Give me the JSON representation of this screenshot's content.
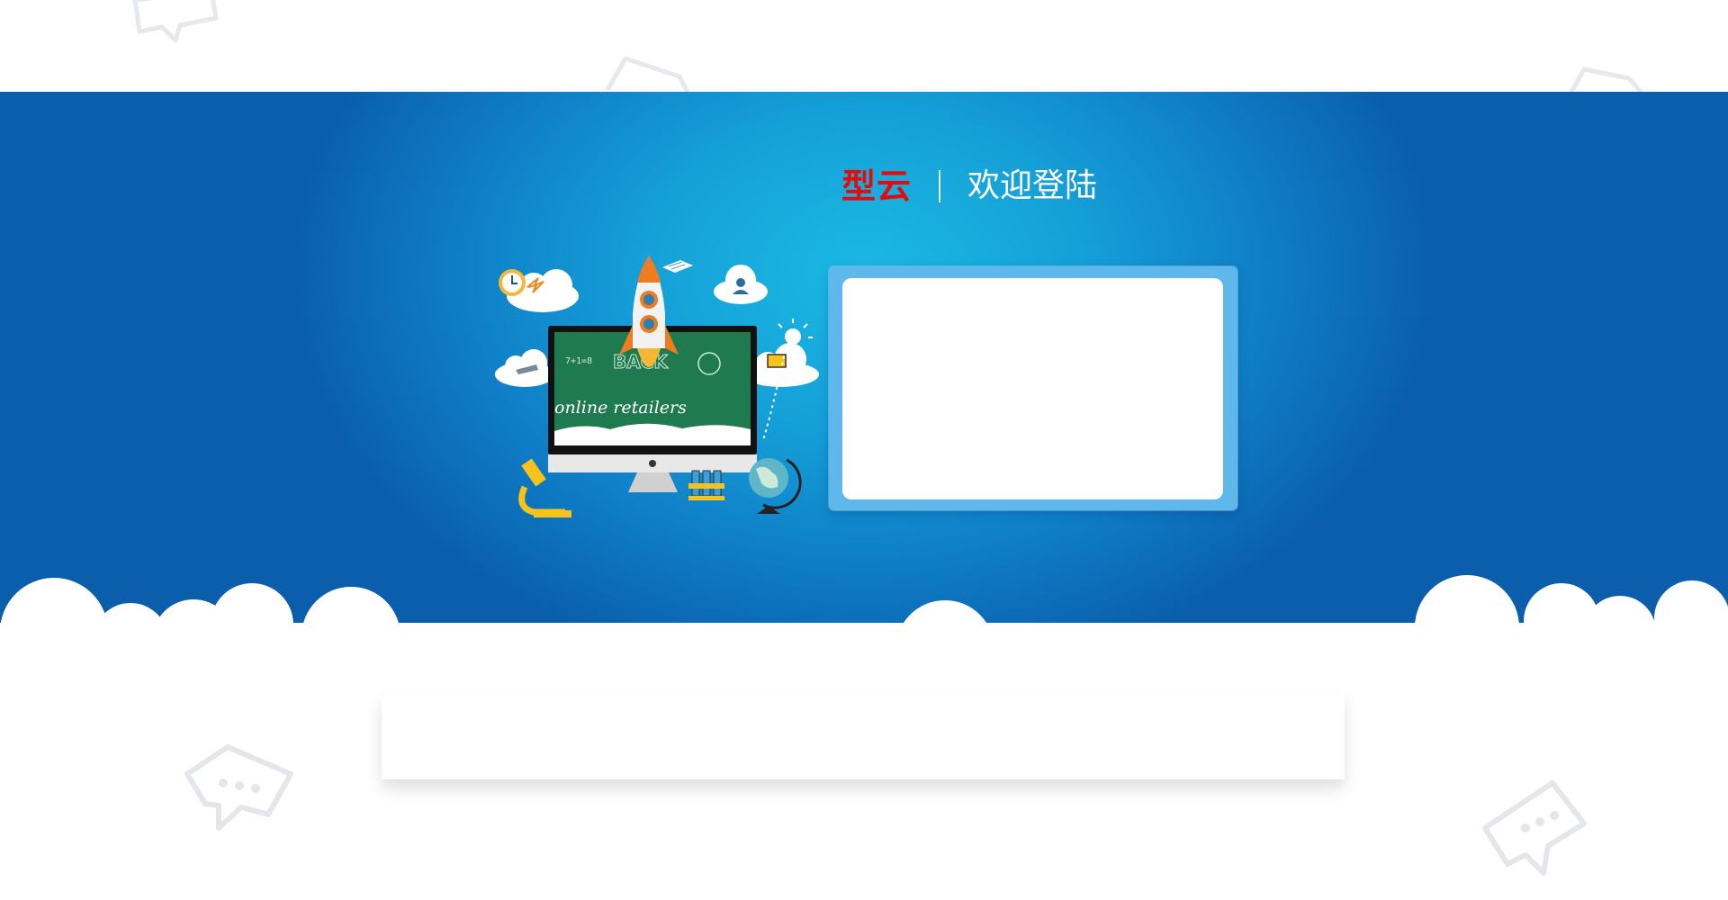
{
  "header": {
    "brand": "型云",
    "welcome": "欢迎登陆"
  },
  "illustration": {
    "board_text": "online retailers",
    "board_caption": "BACK"
  },
  "colors": {
    "brand": "#e60a0a",
    "banner_center": "#1bb9e3",
    "banner_edge": "#0a5eab",
    "frame": "#5eb8ec",
    "board": "#1f7a4f"
  },
  "icons": [
    "chat-bubble-icon",
    "rocket-icon",
    "clock-icon",
    "cloud-icon",
    "microscope-icon",
    "globe-icon",
    "test-tubes-icon",
    "lightbulb-icon",
    "monitor-icon",
    "book-icon"
  ]
}
